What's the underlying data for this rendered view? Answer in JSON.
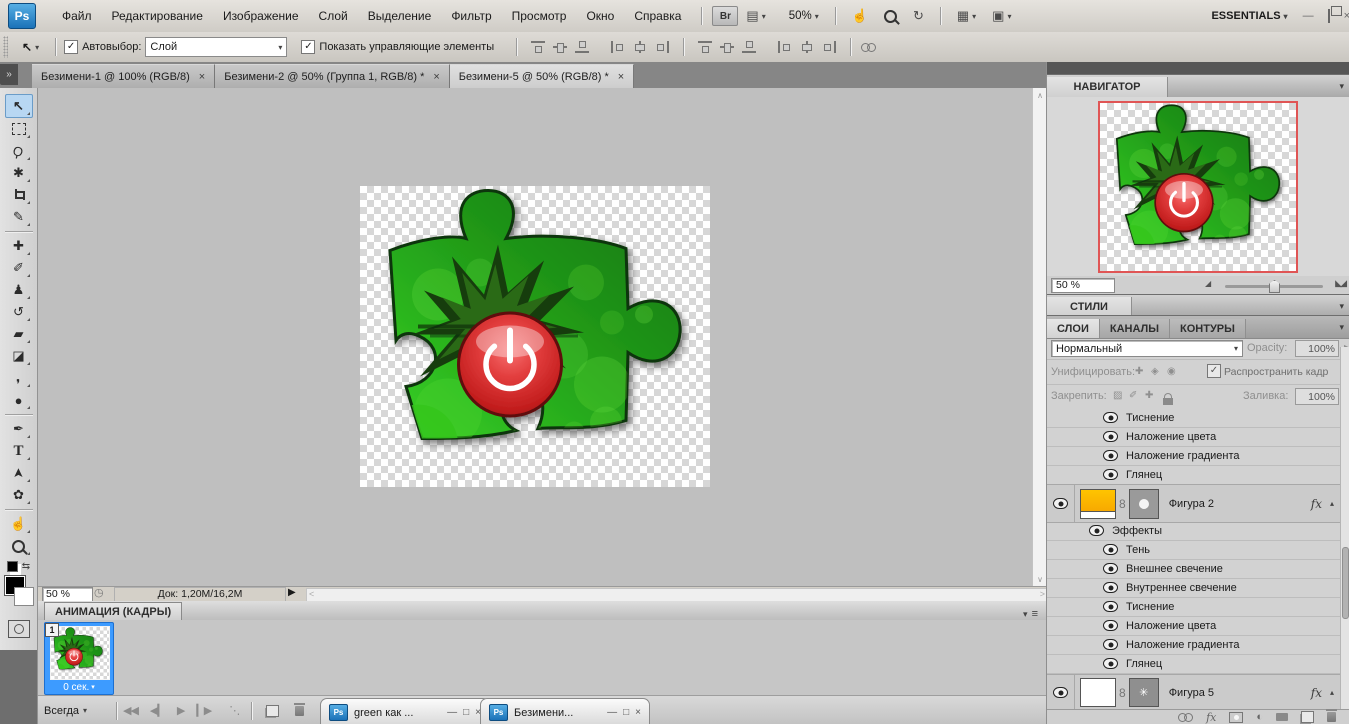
{
  "app": {
    "name": "Adobe Photoshop",
    "logo": "Ps"
  },
  "icons": {
    "chevron_down": "▼",
    "chevron_small_down": "▾",
    "chevron_small_up": "▴",
    "flyout_right": "▸",
    "close": "×",
    "minimize": "—",
    "maximize": "□",
    "collapse_double": "»",
    "check": "✓",
    "view_extras": "▤",
    "arrange_docs": "▦",
    "screen_mode": "▣",
    "hand": "☝",
    "rotate": "↻",
    "swap_colors": "⇆",
    "mountain_small": "◢",
    "mountain_large": "◣◢",
    "black_triangle_right": "▶",
    "status_page": "◷",
    "scroll_up": "∧",
    "scroll_down": "∨",
    "scroll_left": "<",
    "scroll_right": ">",
    "first_frame": "◀◀",
    "prev_frame": "◀▎",
    "play": "▶",
    "next_frame": "▎▶",
    "tween": "⋱",
    "adjustment_circle": "◐",
    "panel_menu": "≡",
    "mask_starburst": "✳",
    "unify_position": "✚",
    "unify_visibility": "◈",
    "unify_style": "◉",
    "lock_transparent": "▨",
    "lock_paint": "✐",
    "lock_position": "✚"
  },
  "menubar": {
    "items": [
      "Файл",
      "Редактирование",
      "Изображение",
      "Слой",
      "Выделение",
      "Фильтр",
      "Просмотр",
      "Окно",
      "Справка"
    ],
    "bridge_label": "Br",
    "zoom_level": "50%",
    "workspace_label": "ESSENTIALS"
  },
  "optionsbar": {
    "autoselect_label": "Автовыбор:",
    "autoselect_value": "Слой",
    "show_transform_label": "Показать управляющие элементы"
  },
  "doc_tabs": [
    {
      "label": "Безимени-1 @ 100% (RGB/8)"
    },
    {
      "label": "Безимени-2 @ 50% (Группа 1, RGB/8) *"
    },
    {
      "label": "Безимени-5 @ 50% (RGB/8) *"
    }
  ],
  "toolbar": {
    "tools": [
      {
        "name": "move-tool",
        "glyph": "↖"
      },
      {
        "name": "marquee-tool",
        "glyph": ""
      },
      {
        "name": "lasso-tool",
        "glyph": "Ϙ"
      },
      {
        "name": "quick-selection-tool",
        "glyph": "✱"
      },
      {
        "name": "crop-tool",
        "glyph": ""
      },
      {
        "name": "eyedropper-tool",
        "glyph": "✎"
      },
      {
        "name": "healing-brush-tool",
        "glyph": "✚"
      },
      {
        "name": "brush-tool",
        "glyph": "✐"
      },
      {
        "name": "clone-stamp-tool",
        "glyph": "♟"
      },
      {
        "name": "history-brush-tool",
        "glyph": "↺"
      },
      {
        "name": "eraser-tool",
        "glyph": "▰"
      },
      {
        "name": "gradient-tool",
        "glyph": "◪"
      },
      {
        "name": "blur-tool",
        "glyph": "❛"
      },
      {
        "name": "burn-tool",
        "glyph": "●"
      },
      {
        "name": "pen-tool",
        "glyph": "✒"
      },
      {
        "name": "type-tool",
        "glyph": "T"
      },
      {
        "name": "path-selection-tool",
        "glyph": "➤"
      },
      {
        "name": "custom-shape-tool",
        "glyph": "✿"
      },
      {
        "name": "hand-tool",
        "glyph": "☝"
      },
      {
        "name": "zoom-tool",
        "glyph": ""
      }
    ]
  },
  "navigator": {
    "title": "НАВИГАТОР",
    "zoom_value": "50 %"
  },
  "styles_panel": {
    "title": "СТИЛИ"
  },
  "layers_panel": {
    "tabs": [
      "СЛОИ",
      "КАНАЛЫ",
      "КОНТУРЫ"
    ],
    "blend_mode": "Нормальный",
    "opacity_label": "Opacity:",
    "opacity_value": "100%",
    "unify_label": "Унифицировать:",
    "propagate_label": "Распространить кадр",
    "lock_label": "Закрепить:",
    "fill_label": "Заливка:",
    "fill_value": "100%",
    "scrolled_effects": [
      "Тиснение",
      "Наложение цвета",
      "Наложение градиента",
      "Глянец"
    ],
    "layer_shape2": "Фигура 2",
    "fx_label": "fx",
    "effects_group_label": "Эффекты",
    "shape2_effects": [
      "Тень",
      "Внешнее свечение",
      "Внутреннее свечение",
      "Тиснение",
      "Наложение цвета",
      "Наложение градиента",
      "Глянец"
    ],
    "layer_shape5": "Фигура 5"
  },
  "statusbar": {
    "zoom_value": "50 %",
    "doc_info": "Док: 1,20М/16,2М"
  },
  "animation": {
    "title": "АНИМАЦИЯ (КАДРЫ)",
    "frame_number": "1",
    "frame_delay": "0 сек.",
    "loop_mode": "Всегда"
  },
  "taskbar": [
    {
      "label": "green как ..."
    },
    {
      "label": "Безимени..."
    }
  ],
  "colors": {
    "tool_selected": "#b8d7f2",
    "selection_blue": "#3d9bff",
    "puzzle_green": "#28a81e",
    "power_button_red": "#d42a2a",
    "navigator_view_red": "#e05555",
    "ps_logo_blue": "#1b72b8"
  }
}
